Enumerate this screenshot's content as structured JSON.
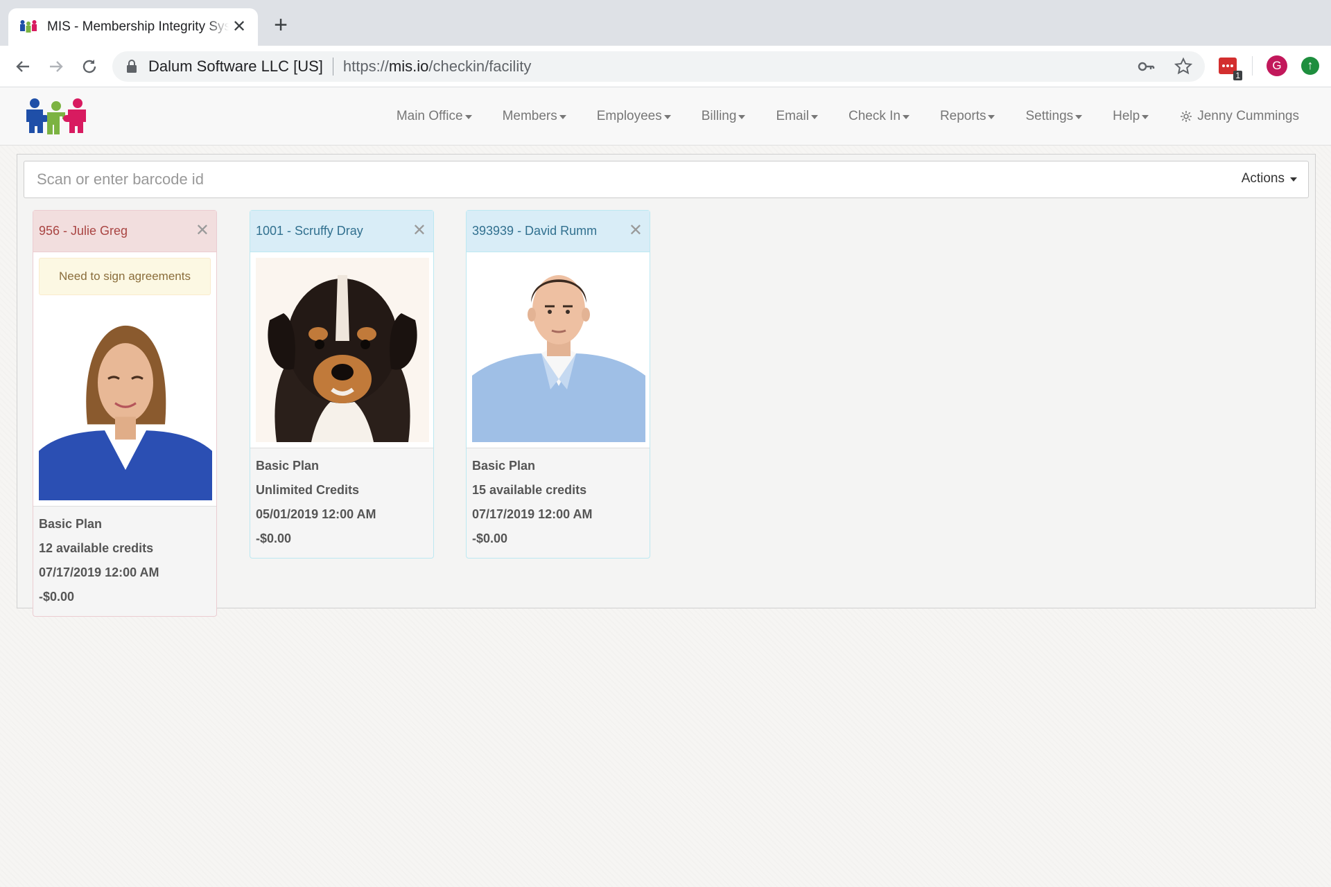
{
  "browser": {
    "tab_title": "MIS - Membership Integrity System",
    "site_identity": "Dalum Software LLC [US]",
    "url_scheme": "https://",
    "url_host": "mis.io",
    "url_path": "/checkin/facility",
    "extension_badge": "1",
    "profile_initial": "G"
  },
  "navbar": {
    "items": [
      {
        "label": "Main Office"
      },
      {
        "label": "Members"
      },
      {
        "label": "Employees"
      },
      {
        "label": "Billing"
      },
      {
        "label": "Email"
      },
      {
        "label": "Check In"
      },
      {
        "label": "Reports"
      },
      {
        "label": "Settings"
      },
      {
        "label": "Help"
      }
    ],
    "user_name": "Jenny Cummings"
  },
  "checkin": {
    "scan_placeholder": "Scan or enter barcode id",
    "actions_label": "Actions",
    "cards": [
      {
        "title": "956 - Julie Greg",
        "status": "danger",
        "warning": "Need to sign agreements",
        "photo": "woman-portrait",
        "plan": "Basic Plan",
        "credits": "12 available credits",
        "date": "07/17/2019 12:00 AM",
        "balance": "-$0.00"
      },
      {
        "title": "1001 - Scruffy Dray",
        "status": "info",
        "photo": "puppy-portrait",
        "plan": "Basic Plan",
        "credits": "Unlimited Credits",
        "date": "05/01/2019 12:00 AM",
        "balance": "-$0.00"
      },
      {
        "title": "393939 - David Rumm",
        "status": "info",
        "photo": "man-portrait",
        "plan": "Basic Plan",
        "credits": "15 available credits",
        "date": "07/17/2019 12:00 AM",
        "balance": "-$0.00"
      }
    ]
  },
  "colors": {
    "danger_bg": "#f2dede",
    "danger_text": "#a94442",
    "info_bg": "#d9edf7",
    "info_text": "#31708f",
    "warning_bg": "#fcf8e3",
    "warning_text": "#8a6d3b"
  }
}
